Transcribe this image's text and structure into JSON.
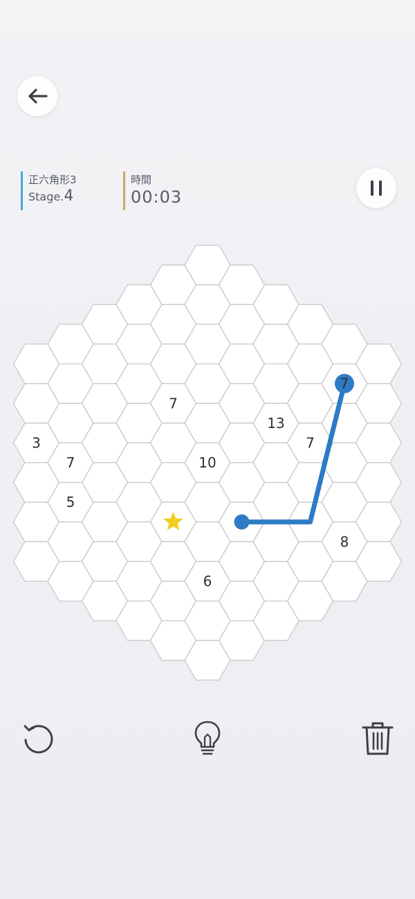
{
  "header": {
    "puzzle_name": "正六角形3",
    "stage_prefix": "Stage.",
    "stage_number": "4",
    "time_label": "時間",
    "time_value": "00:03"
  },
  "colors": {
    "path": "#2d7bc4",
    "star": "#f2cf1f",
    "grid_line": "#c8c8cc",
    "cell_fill": "#ffffff",
    "stage_accent": "#4aa7d6",
    "time_accent": "#c6a96e"
  },
  "icons": {
    "back": "arrow-left-icon",
    "pause": "pause-icon",
    "reset": "rotate-ccw-icon",
    "hint": "lightbulb-icon",
    "clear": "trash-icon"
  },
  "board": {
    "rings": 5,
    "cells": [
      {
        "q": -1,
        "r": -1,
        "label": "7"
      },
      {
        "q": 2,
        "r": -2,
        "label": "13"
      },
      {
        "q": 4,
        "r": -4,
        "label": "7",
        "path_node": true
      },
      {
        "q": 3,
        "r": -2,
        "label": "7"
      },
      {
        "q": -5,
        "r": 2,
        "label": "3"
      },
      {
        "q": 0,
        "r": 0,
        "label": "10"
      },
      {
        "q": -4,
        "r": 2,
        "label": "7"
      },
      {
        "q": 4,
        "r": 0,
        "label": "8"
      },
      {
        "q": -1,
        "r": 2,
        "star": true
      },
      {
        "q": -4,
        "r": 3,
        "label": "5"
      },
      {
        "q": 0,
        "r": 3,
        "label": "6"
      }
    ],
    "path": [
      {
        "q": 4,
        "r": -4
      },
      {
        "q": 3,
        "r": 0
      },
      {
        "q": 1,
        "r": 1
      }
    ]
  }
}
